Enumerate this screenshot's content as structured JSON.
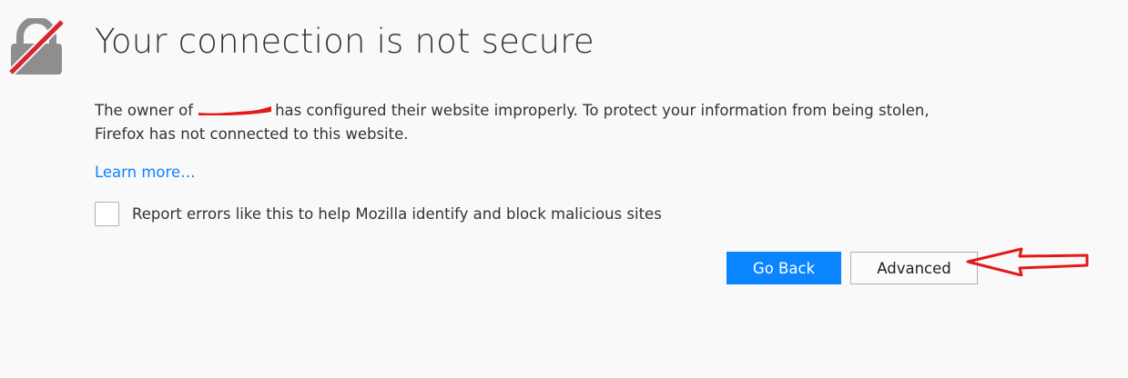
{
  "error_page": {
    "title": "Your connection is not secure",
    "description": {
      "prefix": "The owner of",
      "suffix": "has configured their website improperly. To protect your information from being stolen, Firefox has not connected to this website."
    },
    "learn_more": "Learn more…",
    "report_checkbox": {
      "label": "Report errors like this to help Mozilla identify and block malicious sites",
      "checked": false
    },
    "buttons": {
      "go_back": "Go Back",
      "advanced": "Advanced"
    },
    "icon": "broken-lock-icon",
    "colors": {
      "accent": "#0a84ff",
      "annotation": "#e21a1a",
      "background": "#f9f9fa"
    }
  }
}
